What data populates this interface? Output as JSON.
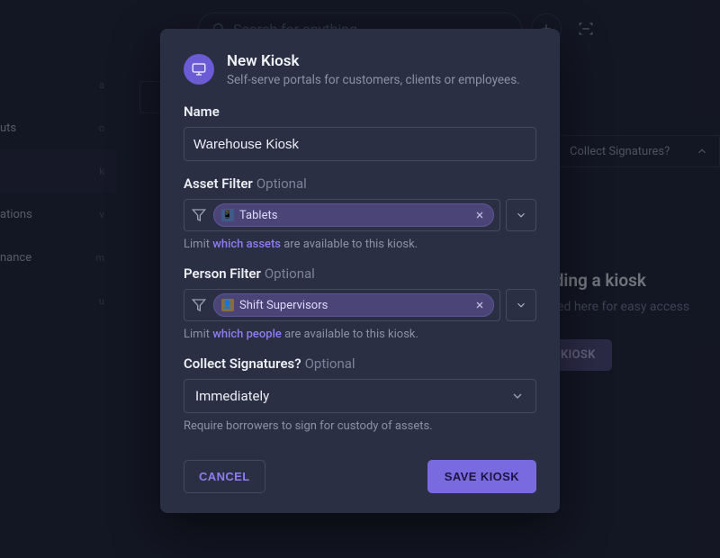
{
  "topbar": {
    "search_placeholder": "Search for anything"
  },
  "sidebar": {
    "items": [
      {
        "label": "",
        "key": "a",
        "selected": false
      },
      {
        "label": "uts",
        "key": "o",
        "selected": false
      },
      {
        "label": "",
        "key": "k",
        "selected": true
      },
      {
        "label": "ations",
        "key": "v",
        "selected": false
      },
      {
        "label": "nance",
        "key": "m",
        "selected": false
      },
      {
        "label": "",
        "key": "u",
        "selected": false
      }
    ]
  },
  "columns": {
    "collect_signatures": "Collect Signatures?"
  },
  "empty_state": {
    "title": "dding a kiosk",
    "subtitle": "ayed here for easy access",
    "button": "KIOSK"
  },
  "modal": {
    "title": "New Kiosk",
    "subtitle": "Self-serve portals for customers, clients or employees.",
    "name_label": "Name",
    "name_value": "Warehouse Kiosk",
    "asset_filter": {
      "label": "Asset Filter",
      "optional": "Optional",
      "chip": "Tablets",
      "helper_prefix": "Limit ",
      "helper_link": "which assets",
      "helper_suffix": " are available to this kiosk."
    },
    "person_filter": {
      "label": "Person Filter",
      "optional": "Optional",
      "chip": "Shift Supervisors",
      "helper_prefix": "Limit ",
      "helper_link": "which people",
      "helper_suffix": " are available to this kiosk."
    },
    "collect_sig": {
      "label": "Collect Signatures?",
      "optional": "Optional",
      "value": "Immediately",
      "helper": "Require borrowers to sign for custody of assets."
    },
    "cancel": "CANCEL",
    "save": "SAVE KIOSK"
  }
}
